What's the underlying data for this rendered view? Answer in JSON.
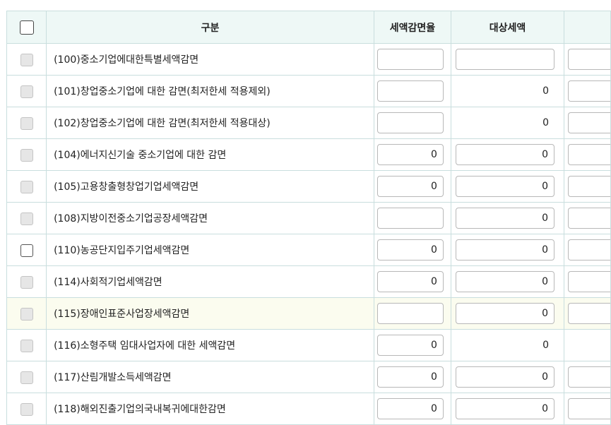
{
  "header": {
    "col_name": "구분",
    "col_rate": "세액감면율",
    "col_target": "대상세액",
    "col_extra": ""
  },
  "rows": [
    {
      "label": "(100)중소기업에대한특별세액감면",
      "checkbox_enabled": false,
      "rate": {
        "kind": "input",
        "value": ""
      },
      "target": {
        "kind": "input",
        "value": ""
      },
      "extra": {
        "kind": "input"
      }
    },
    {
      "label": "(101)창업중소기업에 대한 감면(최저한세 적용제외)",
      "checkbox_enabled": false,
      "rate": {
        "kind": "input",
        "value": ""
      },
      "target": {
        "kind": "text",
        "value": "0"
      },
      "extra": {
        "kind": "input"
      }
    },
    {
      "label": "(102)창업중소기업에 대한 감면(최저한세 적용대상)",
      "checkbox_enabled": false,
      "rate": {
        "kind": "input",
        "value": ""
      },
      "target": {
        "kind": "text",
        "value": "0"
      },
      "extra": {
        "kind": "input"
      }
    },
    {
      "label": "(104)에너지신기술 중소기업에 대한 감면",
      "checkbox_enabled": false,
      "rate": {
        "kind": "input",
        "value": "0"
      },
      "target": {
        "kind": "input",
        "value": "0"
      },
      "extra": {
        "kind": "input"
      }
    },
    {
      "label": "(105)고용창출형창업기업세액감면",
      "checkbox_enabled": false,
      "rate": {
        "kind": "input",
        "value": "0"
      },
      "target": {
        "kind": "input",
        "value": "0"
      },
      "extra": {
        "kind": "input"
      }
    },
    {
      "label": "(108)지방이전중소기업공장세액감면",
      "checkbox_enabled": false,
      "rate": {
        "kind": "input",
        "value": ""
      },
      "target": {
        "kind": "input",
        "value": "0"
      },
      "extra": {
        "kind": "input"
      }
    },
    {
      "label": "(110)농공단지입주기업세액감면",
      "checkbox_enabled": true,
      "rate": {
        "kind": "input",
        "value": "0"
      },
      "target": {
        "kind": "input",
        "value": "0"
      },
      "extra": {
        "kind": "input"
      }
    },
    {
      "label": "(114)사회적기업세액감면",
      "checkbox_enabled": false,
      "rate": {
        "kind": "input",
        "value": "0"
      },
      "target": {
        "kind": "input",
        "value": "0"
      },
      "extra": {
        "kind": "input"
      }
    },
    {
      "label": "(115)장애인표준사업장세액감면",
      "checkbox_enabled": false,
      "highlight": true,
      "rate": {
        "kind": "input",
        "value": ""
      },
      "target": {
        "kind": "input",
        "value": "0"
      },
      "extra": {
        "kind": "input"
      }
    },
    {
      "label": "(116)소형주택 임대사업자에 대한 세액감면",
      "checkbox_enabled": false,
      "rate": {
        "kind": "input",
        "value": "0"
      },
      "target": {
        "kind": "text",
        "value": "0"
      },
      "extra": {
        "kind": "none"
      }
    },
    {
      "label": "(117)산림개발소득세액감면",
      "checkbox_enabled": false,
      "rate": {
        "kind": "input",
        "value": "0"
      },
      "target": {
        "kind": "input",
        "value": "0"
      },
      "extra": {
        "kind": "input"
      }
    },
    {
      "label": "(118)해외진출기업의국내복귀에대한감면",
      "checkbox_enabled": false,
      "rate": {
        "kind": "input",
        "value": "0"
      },
      "target": {
        "kind": "input",
        "value": "0"
      },
      "extra": {
        "kind": "input"
      }
    }
  ]
}
